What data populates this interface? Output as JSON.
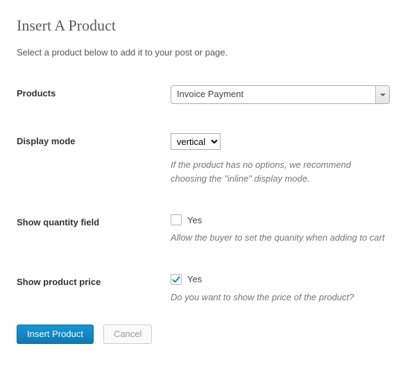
{
  "title": "Insert A Product",
  "subtitle": "Select a product below to add it to your post or page.",
  "fields": {
    "products": {
      "label": "Products",
      "value": "Invoice Payment"
    },
    "display_mode": {
      "label": "Display mode",
      "value": "vertical",
      "helper": "If the product has no options, we recommend choosing the \"inline\" display mode."
    },
    "show_quantity": {
      "label": "Show quantity field",
      "checkbox_label": "Yes",
      "checked": false,
      "helper": "Allow the buyer to set the quanity when adding to cart"
    },
    "show_price": {
      "label": "Show product price",
      "checkbox_label": "Yes",
      "checked": true,
      "helper": "Do you want to show the price of the product?"
    }
  },
  "buttons": {
    "insert": "Insert Product",
    "cancel": "Cancel"
  }
}
